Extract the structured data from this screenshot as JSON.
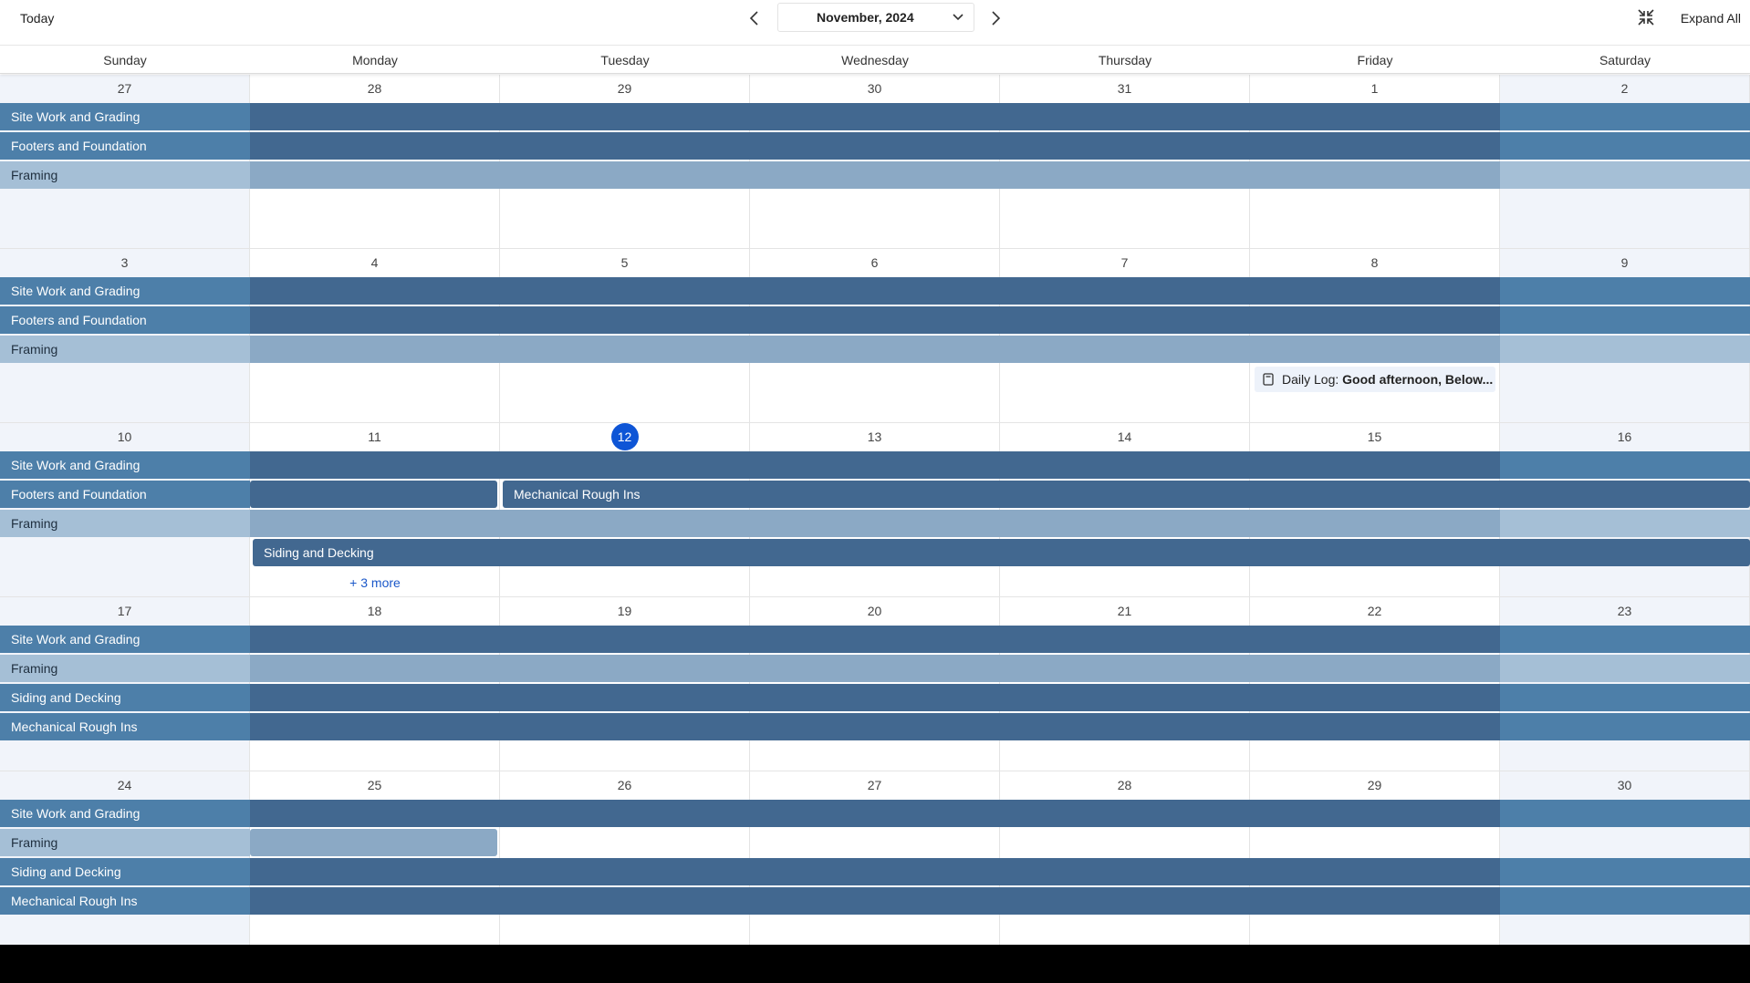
{
  "toolbar": {
    "today_label": "Today",
    "month_label": "November, 2024",
    "expand_all_label": "Expand All"
  },
  "weekdays": [
    "Sunday",
    "Monday",
    "Tuesday",
    "Wednesday",
    "Thursday",
    "Friday",
    "Saturday"
  ],
  "today": "12",
  "colors": {
    "bar_dark": "#426890",
    "bar_dark_edge": "#4d7fa9",
    "bar_light": "#8ba9c5",
    "bar_light_edge": "#a5bfd6",
    "today_badge": "#0e55d6",
    "link": "#1b58c9",
    "weekend_bg": "#f1f4fa"
  },
  "weeks": [
    {
      "days": [
        "27",
        "28",
        "29",
        "30",
        "31",
        "1",
        "2"
      ],
      "events": [
        {
          "title": "Site Work and Grading",
          "tone": "dark",
          "start": 0,
          "end": 6
        },
        {
          "title": "Footers and Foundation",
          "tone": "dark",
          "start": 0,
          "end": 6
        },
        {
          "title": "Framing",
          "tone": "light",
          "start": 0,
          "end": 6
        }
      ]
    },
    {
      "days": [
        "3",
        "4",
        "5",
        "6",
        "7",
        "8",
        "9"
      ],
      "events": [
        {
          "title": "Site Work and Grading",
          "tone": "dark",
          "start": 0,
          "end": 6
        },
        {
          "title": "Footers and Foundation",
          "tone": "dark",
          "start": 0,
          "end": 6
        },
        {
          "title": "Framing",
          "tone": "light",
          "start": 0,
          "end": 6
        }
      ],
      "log": {
        "day": 5,
        "prefix": "Daily Log: ",
        "text": "Good afternoon, Below..."
      }
    },
    {
      "days": [
        "10",
        "11",
        "12",
        "13",
        "14",
        "15",
        "16"
      ],
      "events": [
        {
          "title": "Site Work and Grading",
          "tone": "dark",
          "start": 0,
          "end": 6
        },
        {
          "title": "Footers and Foundation",
          "tone": "dark",
          "start": 0,
          "end": 1
        },
        {
          "title": "Mechanical Rough Ins",
          "tone": "dark",
          "start": 2,
          "end": 6,
          "row": 1,
          "label": true
        },
        {
          "title": "Framing",
          "tone": "light",
          "start": 0,
          "end": 6
        },
        {
          "title": "Siding and Decking",
          "tone": "dark",
          "start": 1,
          "end": 6,
          "label": true
        }
      ],
      "more": {
        "day": 1,
        "label": "+ 3 more"
      }
    },
    {
      "days": [
        "17",
        "18",
        "19",
        "20",
        "21",
        "22",
        "23"
      ],
      "events": [
        {
          "title": "Site Work and Grading",
          "tone": "dark",
          "start": 0,
          "end": 6
        },
        {
          "title": "Framing",
          "tone": "light",
          "start": 0,
          "end": 6
        },
        {
          "title": "Siding and Decking",
          "tone": "dark",
          "start": 0,
          "end": 6
        },
        {
          "title": "Mechanical Rough Ins",
          "tone": "dark",
          "start": 0,
          "end": 6
        }
      ]
    },
    {
      "days": [
        "24",
        "25",
        "26",
        "27",
        "28",
        "29",
        "30"
      ],
      "events": [
        {
          "title": "Site Work and Grading",
          "tone": "dark",
          "start": 0,
          "end": 6
        },
        {
          "title": "Framing",
          "tone": "light",
          "start": 0,
          "end": 1
        },
        {
          "title": "Siding and Decking",
          "tone": "dark",
          "start": 0,
          "end": 6
        },
        {
          "title": "Mechanical Rough Ins",
          "tone": "dark",
          "start": 0,
          "end": 6
        }
      ]
    }
  ]
}
